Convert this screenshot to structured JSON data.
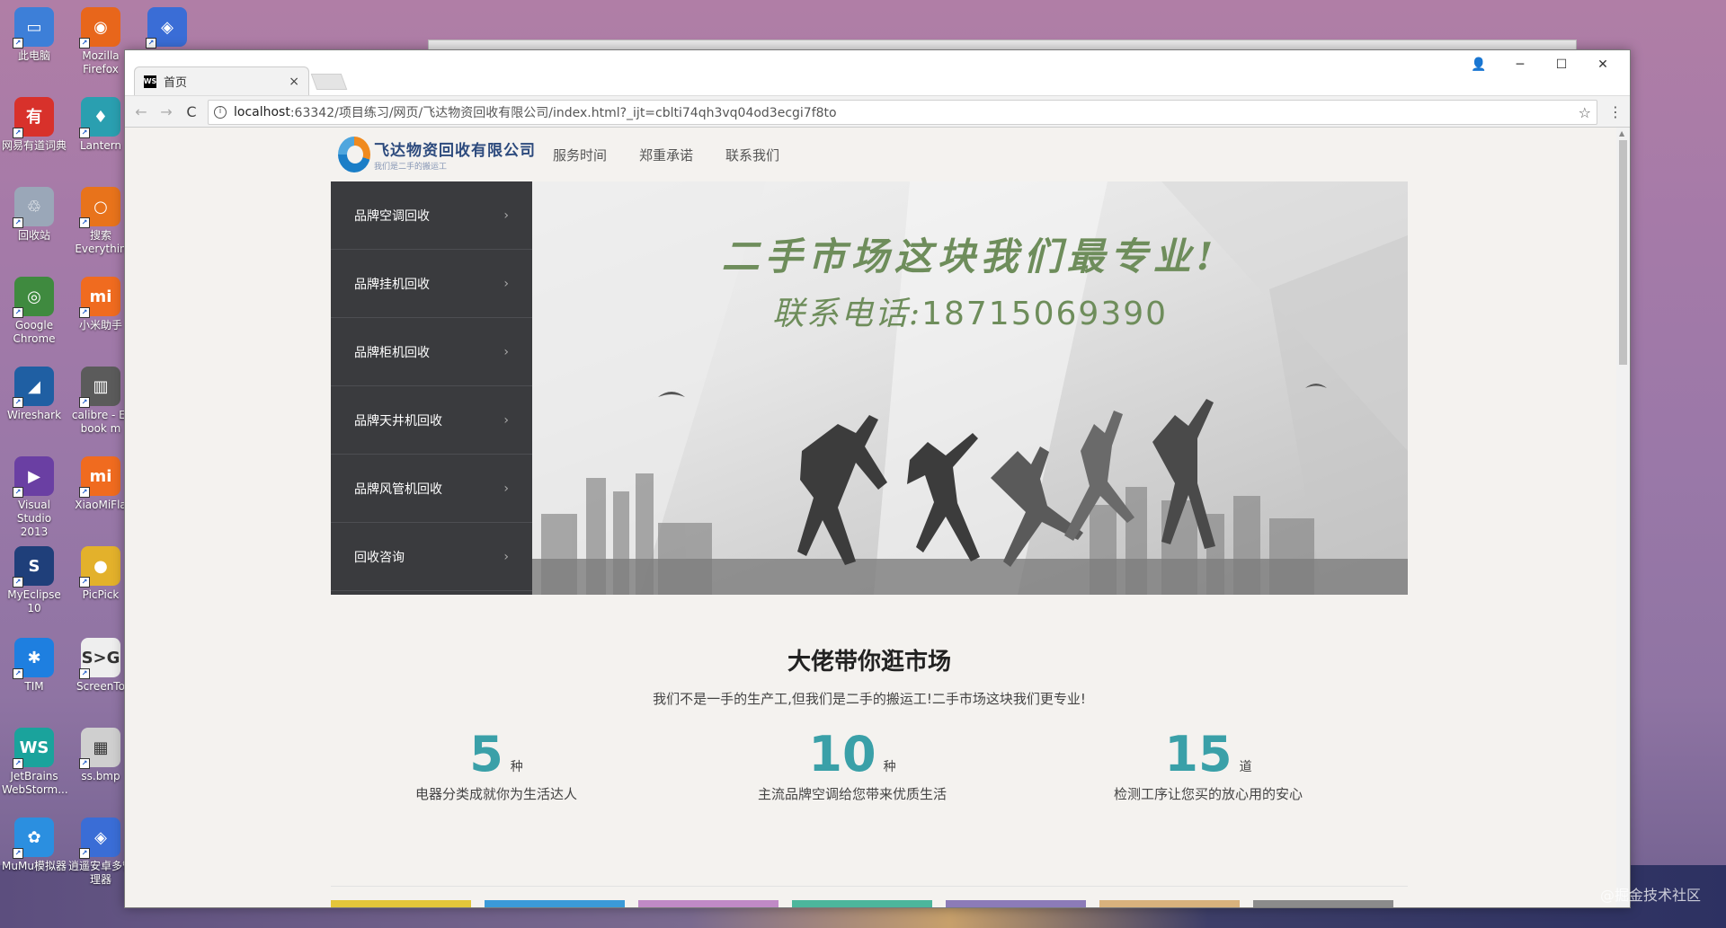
{
  "desktop": {
    "icons": [
      {
        "label": "此电脑",
        "color": "#3d7fd8",
        "glyph": "▭"
      },
      {
        "label": "Mozilla Firefox",
        "color": "#e8661b",
        "glyph": "◉"
      },
      {
        "label": "",
        "color": "#3a6dd6",
        "glyph": "◈"
      },
      {
        "label": "网易有道词典",
        "color": "#d8312b",
        "glyph": "有"
      },
      {
        "label": "Lantern",
        "color": "#2a9fb0",
        "glyph": "♦"
      },
      {
        "label": "回收站",
        "color": "#9aa7b8",
        "glyph": "♲"
      },
      {
        "label": "搜索 Everythin",
        "color": "#e8731b",
        "glyph": "○"
      },
      {
        "label": "Google Chrome",
        "color": "#3f8a3f",
        "glyph": "◎"
      },
      {
        "label": "小米助手",
        "color": "#f06b1f",
        "glyph": "mi"
      },
      {
        "label": "Wireshark",
        "color": "#1f5fa3",
        "glyph": "◢"
      },
      {
        "label": "calibre - E-book m",
        "color": "#5b5b5b",
        "glyph": "▥"
      },
      {
        "label": "Visual Studio 2013",
        "color": "#6a3fa3",
        "glyph": "▶"
      },
      {
        "label": "XiaoMiFla",
        "color": "#f06b1f",
        "glyph": "mi"
      },
      {
        "label": "MyEclipse 10",
        "color": "#1f3f7a",
        "glyph": "S"
      },
      {
        "label": "PicPick",
        "color": "#e3b12b",
        "glyph": "●"
      },
      {
        "label": "TIM",
        "color": "#1e7fe0",
        "glyph": "✱"
      },
      {
        "label": "ScreenTo",
        "color": "#eeeeee",
        "glyph": "S>G"
      },
      {
        "label": "JetBrains WebStorm...",
        "color": "#1aa39c",
        "glyph": "WS"
      },
      {
        "label": "ss.bmp",
        "color": "#cfcfcf",
        "glyph": "▦"
      },
      {
        "label": "MuMu模拟器",
        "color": "#2b8fe0",
        "glyph": "✿"
      },
      {
        "label": "逍遥安卓多管理器",
        "color": "#3a6dd6",
        "glyph": "◈"
      }
    ]
  },
  "browser": {
    "tab_title": "首页",
    "tab_favicon": "WS",
    "tab_close": "×",
    "window_controls": {
      "account": "👤",
      "minimize": "─",
      "maximize": "☐",
      "close": "✕"
    },
    "nav": {
      "back": "←",
      "forward": "→",
      "reload": "C"
    },
    "url_host": "localhost",
    "url_rest": ":63342/项目练习/网页/飞达物资回收有限公司/index.html?_ijt=cblti74qh3vq04od3ecgi7f8to",
    "bookmark_icon": "☆",
    "menu_icon": "⋮"
  },
  "site": {
    "logo_name": "飞达物资回收有限公司",
    "logo_sub": "我们是二手的搬运工",
    "nav": [
      "服务时间",
      "郑重承诺",
      "联系我们"
    ],
    "side_menu": [
      "品牌空调回收",
      "品牌挂机回收",
      "品牌柜机回收",
      "品牌天井机回收",
      "品牌风管机回收",
      "回收咨询"
    ],
    "chevron": "›",
    "banner_slogan": "二手市场这块我们最专业!",
    "banner_phone_label": "联系电话:",
    "banner_phone": "18715069390",
    "section_title": "大佬带你逛市场",
    "section_sub": "我们不是一手的生产工,但我们是二手的搬运工!二手市场这块我们更专业!",
    "stats": [
      {
        "num": "5",
        "unit": "种",
        "desc": "电器分类成就你为生活达人"
      },
      {
        "num": "10",
        "unit": "种",
        "desc": "主流品牌空调给您带来优质生活"
      },
      {
        "num": "15",
        "unit": "道",
        "desc": "检测工序让您买的放心用的安心"
      }
    ],
    "card_colors": [
      "#e3c63a",
      "#3b9ad8",
      "#c08ac6",
      "#4cb69c",
      "#8c7bb8",
      "#d8b27d",
      "#8b8b8b"
    ]
  },
  "watermark": "@掘金技术社区"
}
